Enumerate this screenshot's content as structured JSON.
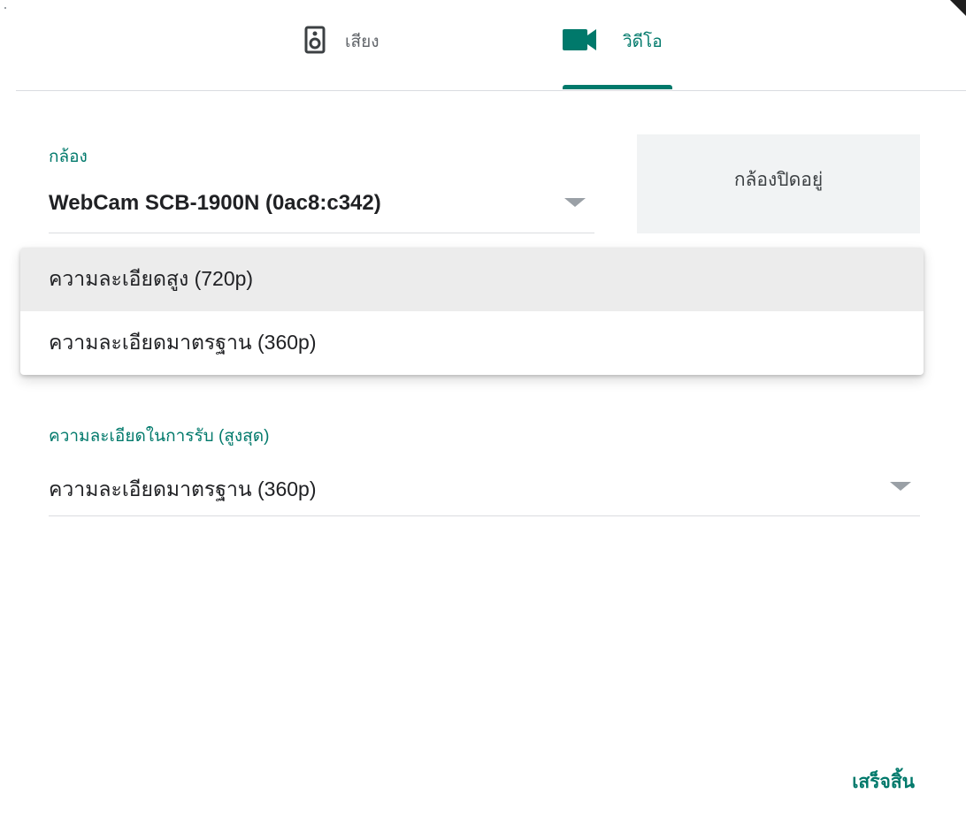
{
  "tabs": {
    "audio_label": "เสียง",
    "video_label": "วิดีโอ"
  },
  "camera": {
    "label": "กล้อง",
    "value": "WebCam SCB-1900N (0ac8:c342)",
    "preview_text": "กล้องปิดอยู่"
  },
  "send_resolution_menu": {
    "options": [
      {
        "label": "ความละเอียดสูง (720p)",
        "selected": true
      },
      {
        "label": "ความละเอียดมาตรฐาน (360p)",
        "selected": false
      }
    ]
  },
  "receive_resolution": {
    "label": "ความละเอียดในการรับ (สูงสุด)",
    "value": "ความละเอียดมาตรฐาน (360p)"
  },
  "footer": {
    "done_label": "เสร็จสิ้น"
  },
  "colors": {
    "accent": "#00796b",
    "divider": "#dadce0",
    "preview_bg": "#f1f3f4"
  },
  "icons": {
    "audio_tab": "speaker-icon",
    "video_tab": "videocam-icon",
    "dropdown": "chevron-down-icon"
  }
}
